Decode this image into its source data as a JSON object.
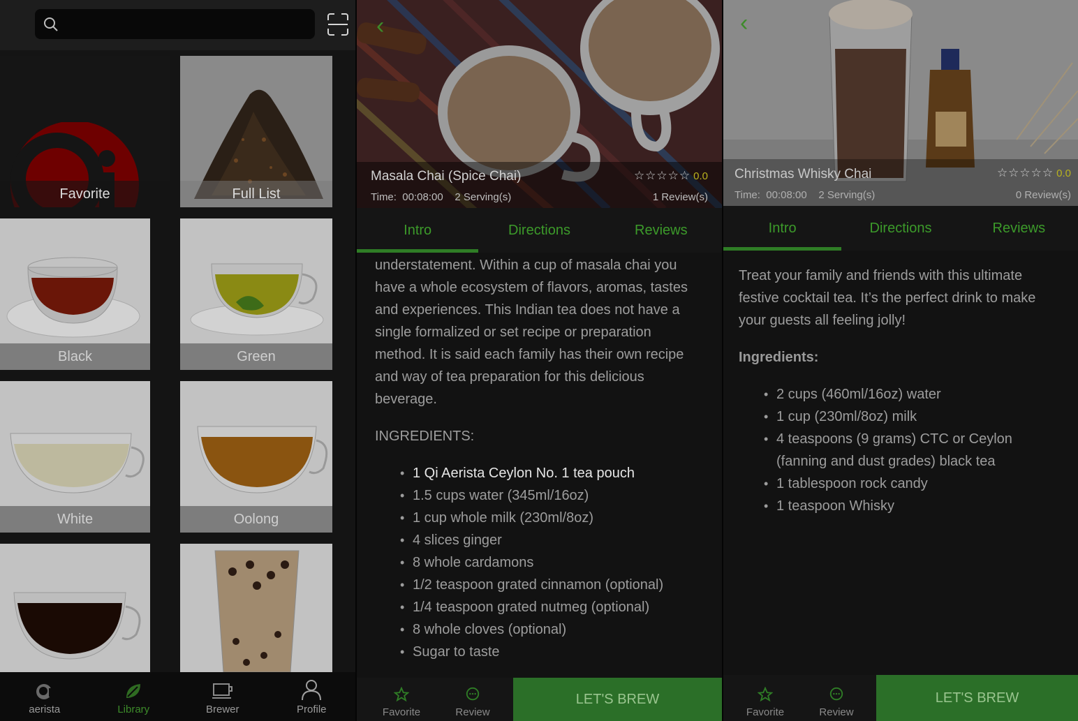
{
  "library": {
    "search": {
      "placeholder": ""
    },
    "tiles": [
      {
        "label": "Favorite"
      },
      {
        "label": "Full List"
      },
      {
        "label": "Black"
      },
      {
        "label": "Green"
      },
      {
        "label": "White"
      },
      {
        "label": "Oolong"
      },
      {
        "label": ""
      },
      {
        "label": ""
      }
    ],
    "nav": [
      {
        "label": "aerista",
        "icon": "aerista-logo-icon"
      },
      {
        "label": "Library",
        "icon": "leaf-icon"
      },
      {
        "label": "Brewer",
        "icon": "brewer-icon"
      },
      {
        "label": "Profile",
        "icon": "person-icon"
      }
    ]
  },
  "recipe1": {
    "title": "Masala Chai (Spice Chai)",
    "time_label": "Time:",
    "time": "00:08:00",
    "servings": "2 Serving(s)",
    "stars": "☆☆☆☆☆",
    "rating": "0.0",
    "reviews": "1 Review(s)",
    "tabs": [
      "Intro",
      "Directions",
      "Reviews"
    ],
    "intro": "understatement. Within a cup of masala chai you have a whole ecosystem of flavors, aromas, tastes and experiences. This Indian tea does not have a single formalized or set recipe or preparation method. It is said each family has their own recipe and way of tea preparation for this delicious beverage.",
    "ingredients_heading": "INGREDIENTS:",
    "ingredients": [
      "1 Qi Aerista Ceylon No. 1 tea pouch",
      "1.5 cups water (345ml/16oz)",
      "1 cup whole milk (230ml/8oz)",
      "4 slices ginger",
      "8 whole cardamons",
      "1/2 teaspoon grated cinnamon (optional)",
      "1/4 teaspoon grated nutmeg (optional)",
      "8 whole cloves (optional)",
      "Sugar to taste"
    ],
    "favorite_label": "Favorite",
    "review_label": "Review",
    "brew_label": "LET'S BREW"
  },
  "recipe2": {
    "title": "Christmas Whisky Chai",
    "time_label": "Time:",
    "time": "00:08:00",
    "servings": "2 Serving(s)",
    "stars": "☆☆☆☆☆",
    "rating": "0.0",
    "reviews": "0 Review(s)",
    "tabs": [
      "Intro",
      "Directions",
      "Reviews"
    ],
    "intro": "Treat your family and friends with this ultimate festive cocktail tea. It’s the perfect drink to make your guests all feeling jolly!",
    "ingredients_heading": "Ingredients:",
    "ingredients": [
      "2 cups (460ml/16oz) water",
      "1 cup (230ml/8oz) milk",
      "4 teaspoons (9 grams) CTC or Ceylon (fanning and dust grades) black tea",
      "1 tablespoon rock candy",
      "1 teaspoon Whisky"
    ],
    "favorite_label": "Favorite",
    "review_label": "Review",
    "brew_label": "LET'S BREW"
  },
  "colors": {
    "accent_green": "#2f7d26",
    "brand_red": "#b00000",
    "rating_yellow": "#b9b21e"
  }
}
